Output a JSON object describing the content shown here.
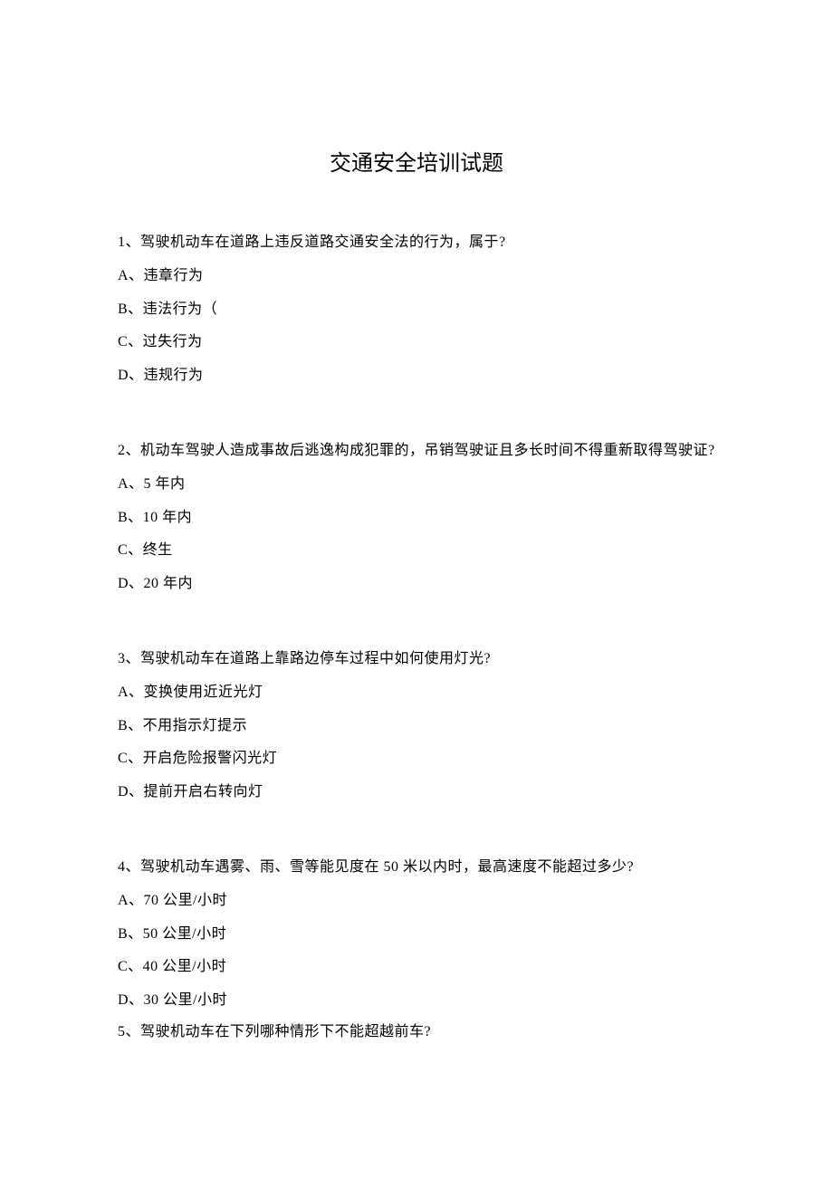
{
  "title": "交通安全培训试题",
  "questions": [
    {
      "q": "1、驾驶机动车在道路上违反道路交通安全法的行为，属于?",
      "options": [
        "A、违章行为",
        "B、违法行为（",
        "C、过失行为",
        "D、违规行为"
      ]
    },
    {
      "q": "2、机动车驾驶人造成事故后逃逸构成犯罪的，吊销驾驶证且多长时间不得重新取得驾驶证?",
      "options": [
        "A、5 年内",
        "B、10 年内",
        "C、终生",
        "D、20 年内"
      ]
    },
    {
      "q": "3、驾驶机动车在道路上靠路边停车过程中如何使用灯光?",
      "options": [
        "A、变换使用近近光灯",
        "B、不用指示灯提示",
        "C、开启危险报警闪光灯",
        "D、提前开启右转向灯"
      ]
    },
    {
      "q": "4、驾驶机动车遇雾、雨、雪等能见度在 50 米以内时，最高速度不能超过多少?",
      "options": [
        "A、70 公里/小时",
        "B、50 公里/小时",
        "C、40 公里/小时",
        "D、30 公里/小时"
      ]
    },
    {
      "q": "5、驾驶机动车在下列哪种情形下不能超越前车?",
      "options": []
    }
  ]
}
